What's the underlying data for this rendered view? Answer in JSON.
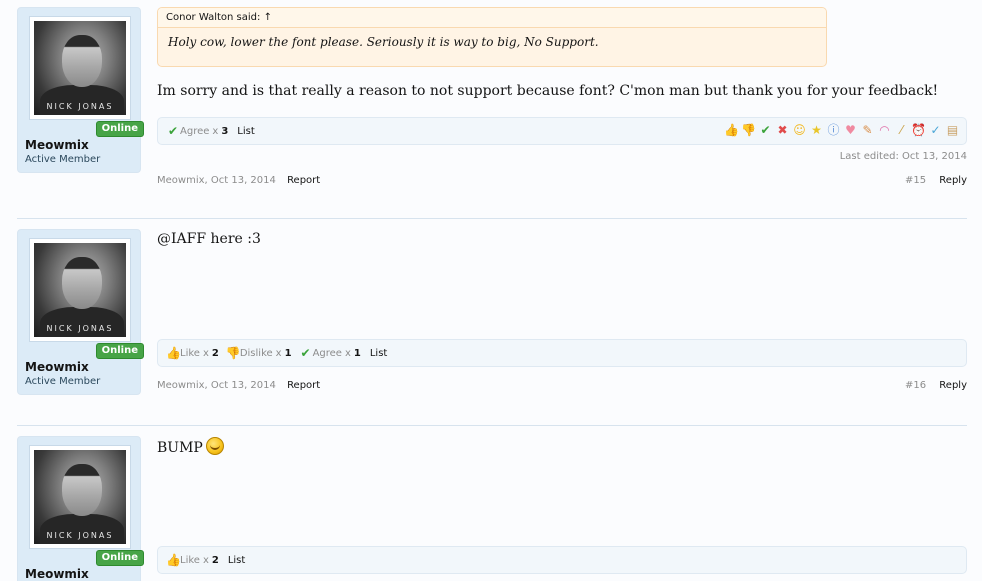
{
  "posts": [
    {
      "user": {
        "name": "Meowmix",
        "title": "Active Member",
        "status": "Online",
        "avatar_caption": "NICK JONAS"
      },
      "quote": {
        "header": "Conor Walton said: ↑",
        "text": "Holy cow, lower the font please. Seriously it is way to big, No Support."
      },
      "message": "Im sorry and is that really a reason to not support because font? C'mon man but thank you for your feedback!",
      "ratings": [
        {
          "icon": "agree-icon",
          "label": "Agree",
          "x": "x",
          "count": "3"
        }
      ],
      "list_label": "List",
      "rate_icons": [
        "like-icon",
        "dislike-icon",
        "agree-icon",
        "disagree-icon",
        "funny-icon",
        "winner-icon",
        "informative-icon",
        "friendly-icon",
        "useful-icon",
        "creative-icon",
        "optimistic-icon",
        "late-icon",
        "spelling-icon",
        "box-icon"
      ],
      "last_edited": "Last edited: Oct 13, 2014",
      "author": "Meowmix",
      "date": "Oct 13, 2014",
      "report": "Report",
      "number": "#15",
      "reply": "Reply"
    },
    {
      "user": {
        "name": "Meowmix",
        "title": "Active Member",
        "status": "Online",
        "avatar_caption": "NICK JONAS"
      },
      "message": "@IAFF here :3",
      "ratings": [
        {
          "icon": "like-icon",
          "label": "Like",
          "x": "x",
          "count": "2"
        },
        {
          "icon": "dislike-icon",
          "label": "Dislike",
          "x": "x",
          "count": "1"
        },
        {
          "icon": "agree-icon",
          "label": "Agree",
          "x": "x",
          "count": "1"
        }
      ],
      "list_label": "List",
      "author": "Meowmix",
      "date": "Oct 13, 2014",
      "report": "Report",
      "number": "#16",
      "reply": "Reply"
    },
    {
      "user": {
        "name": "Meowmix",
        "status": "Online",
        "avatar_caption": "NICK JONAS"
      },
      "message": "BUMP",
      "ratings": [
        {
          "icon": "like-icon",
          "label": "Like",
          "x": "x",
          "count": "2"
        }
      ],
      "list_label": "List"
    }
  ]
}
